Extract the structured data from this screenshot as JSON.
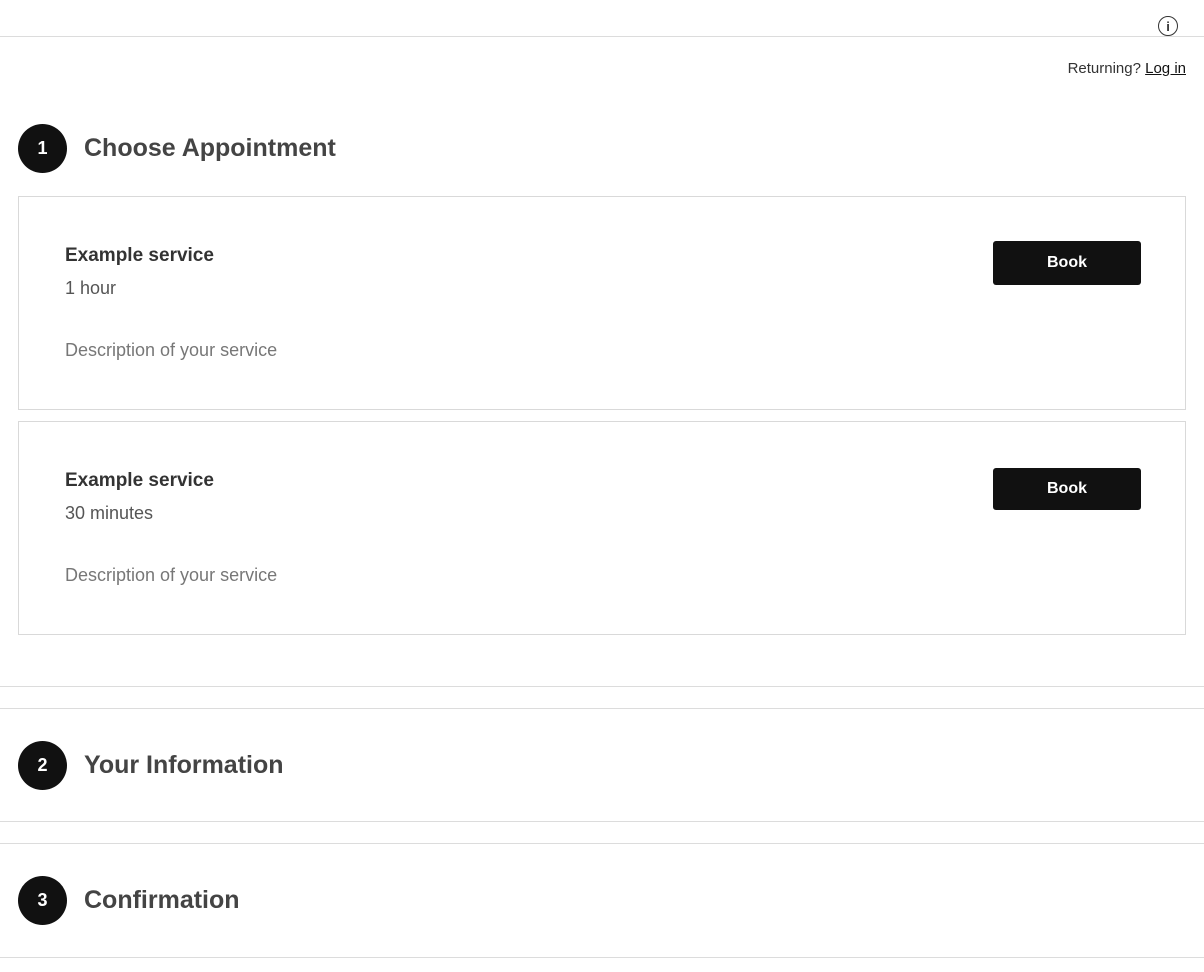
{
  "header": {
    "info_icon": "i",
    "returning_text": "Returning?",
    "login_label": "Log in"
  },
  "steps": [
    {
      "number": "1",
      "title": "Choose Appointment"
    },
    {
      "number": "2",
      "title": "Your Information"
    },
    {
      "number": "3",
      "title": "Confirmation"
    }
  ],
  "services": [
    {
      "name": "Example service",
      "duration": "1 hour",
      "description": "Description of your service",
      "button_label": "Book"
    },
    {
      "name": "Example service",
      "duration": "30 minutes",
      "description": "Description of your service",
      "button_label": "Book"
    }
  ],
  "colors": {
    "primary": "#111111",
    "border": "#d9d9d9",
    "muted_text": "#777777"
  }
}
